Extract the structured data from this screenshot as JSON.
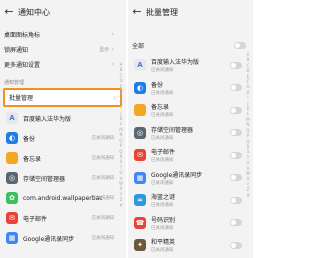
{
  "left": {
    "title": "通知中心",
    "rows": [
      {
        "label": "桌面图标角标"
      },
      {
        "label": "锁屏通知",
        "value": "显示"
      },
      {
        "label": "更多通知设置"
      }
    ],
    "section": "通知管理",
    "batch_label": "批量管理",
    "apps": [
      {
        "name": "百度输入法华为版",
        "icon": "A",
        "color": "#e8e8e8",
        "glyph_color": "#4a78d9"
      },
      {
        "name": "备份",
        "icon": "◐",
        "color": "#1f7de8",
        "status": "已关闭通知"
      },
      {
        "name": "备忘录",
        "icon": "",
        "color": "#f5a623",
        "status": "已关闭通知"
      },
      {
        "name": "存储空间管理器",
        "icon": "◎",
        "color": "#5a6670",
        "status": "已关闭通知"
      },
      {
        "name": "com.android.wallpaperbac...",
        "icon": "✿",
        "color": "#3dbf5e",
        "status": "已关闭通知"
      },
      {
        "name": "电子邮件",
        "icon": "✉",
        "color": "#e94335",
        "status": "已关闭通知"
      },
      {
        "name": "Google通讯录同步",
        "icon": "▦",
        "color": "#4285f4",
        "status": "已关闭通知"
      }
    ],
    "alpha": [
      "A",
      "B",
      "C",
      "D",
      "E",
      "F",
      "G",
      "H",
      "I",
      "J",
      "K",
      "L",
      "M",
      "N",
      "O",
      "P",
      "Q",
      "R",
      "S",
      "T",
      "U",
      "V",
      "W",
      "X",
      "Y",
      "Z",
      "#"
    ]
  },
  "right": {
    "title": "批量管理",
    "select_all": "全部",
    "apps": [
      {
        "name": "百度输入法华为版",
        "sub": "已关闭通知",
        "icon": "A",
        "color": "#e8e8e8",
        "glyph_color": "#4a78d9"
      },
      {
        "name": "备份",
        "sub": "已关闭通知",
        "icon": "◐",
        "color": "#1f7de8"
      },
      {
        "name": "备忘录",
        "sub": "已关闭通知",
        "icon": "",
        "color": "#f5a623"
      },
      {
        "name": "存储空间管理器",
        "sub": "已关闭通知",
        "icon": "◎",
        "color": "#5a6670"
      },
      {
        "name": "电子邮件",
        "sub": "已关闭通知",
        "icon": "✉",
        "color": "#e94335"
      },
      {
        "name": "Google通讯录同步",
        "sub": "已关闭通知",
        "icon": "▦",
        "color": "#4285f4"
      },
      {
        "name": "海蓝之谜",
        "sub": "已关闭通知",
        "icon": "≈",
        "color": "#2b9ad8"
      },
      {
        "name": "号码识别",
        "sub": "已关闭通知",
        "icon": "☎",
        "color": "#e6453a"
      },
      {
        "name": "和平精英",
        "sub": "已关闭通知",
        "icon": "✦",
        "color": "#6b5a3a"
      }
    ],
    "alpha": [
      "A",
      "B",
      "C",
      "D",
      "E",
      "F",
      "G",
      "H",
      "I",
      "J",
      "K",
      "L",
      "M",
      "N",
      "O",
      "P",
      "Q",
      "R",
      "S",
      "T",
      "U",
      "V",
      "W",
      "X",
      "Y",
      "Z",
      "#"
    ]
  }
}
